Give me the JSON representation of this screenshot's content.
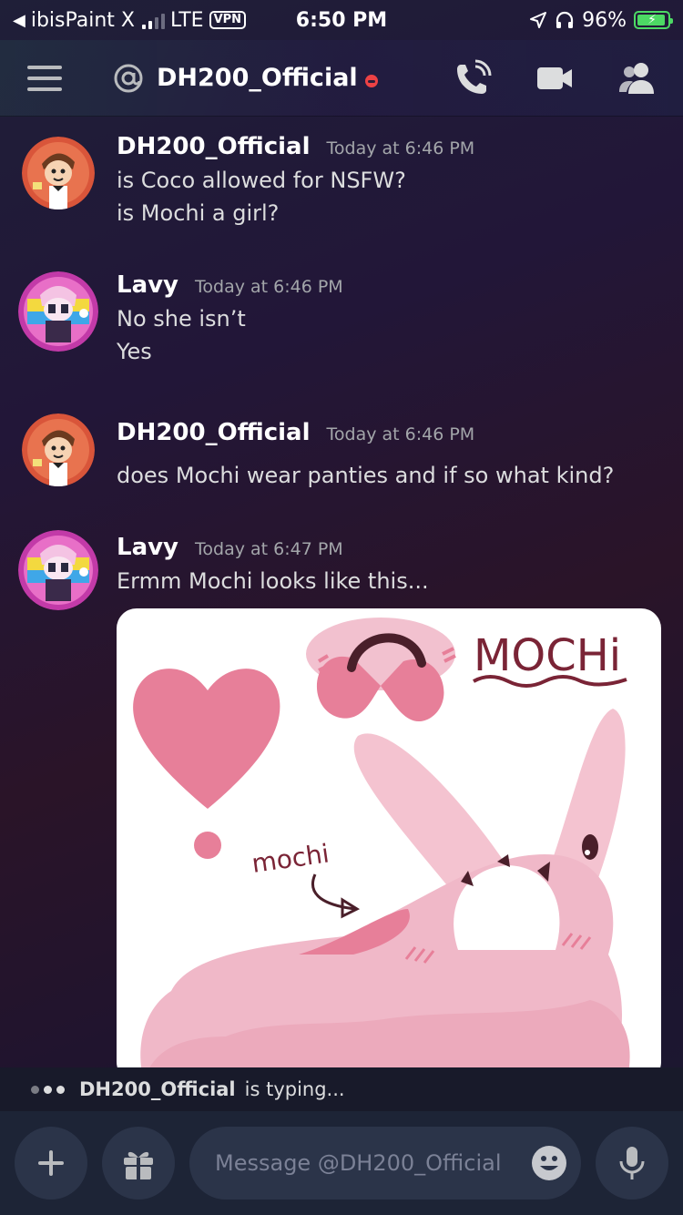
{
  "status_bar": {
    "back_app": "ibisPaint X",
    "carrier": "LTE",
    "vpn": "VPN",
    "time": "6:50 PM",
    "battery": "96%"
  },
  "header": {
    "channel": "DH200_Official"
  },
  "messages": [
    {
      "author": "DH200_Official",
      "timestamp": "Today at 6:46 PM",
      "lines": [
        "is Coco allowed for NSFW?",
        "is Mochi a girl?"
      ]
    },
    {
      "author": "Lavy",
      "timestamp": "Today at 6:46 PM",
      "lines": [
        "No she isn’t",
        "Yes"
      ]
    },
    {
      "author": "DH200_Official",
      "timestamp": "Today at 6:46 PM",
      "lines": [
        "does Mochi wear panties and if so what kind?"
      ]
    },
    {
      "author": "Lavy",
      "timestamp": "Today at 6:47 PM",
      "lines": [
        "Ermm Mochi looks like this..."
      ]
    }
  ],
  "attachment": {
    "title_text": "MOCHi",
    "caption_text": "mochi"
  },
  "typing": {
    "name": "DH200_Official",
    "suffix": "is typing..."
  },
  "composer": {
    "placeholder": "Message @DH200_Official"
  }
}
